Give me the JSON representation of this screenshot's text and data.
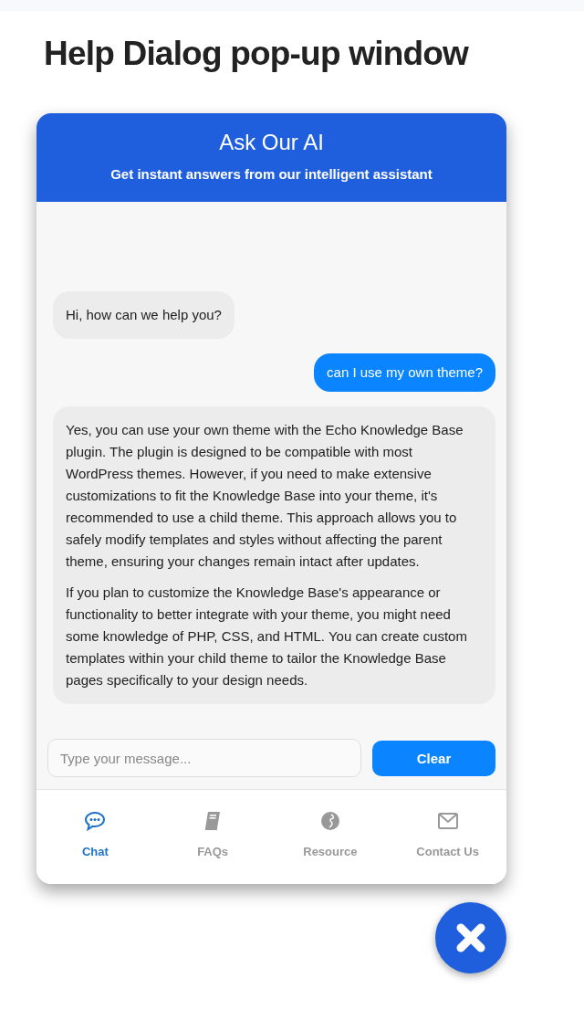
{
  "page_title": "Help Dialog pop-up window",
  "dialog": {
    "title": "Ask Our AI",
    "subtitle": "Get instant answers from our intelligent assistant"
  },
  "messages": [
    {
      "kind": "bot",
      "paragraphs": [
        "Hi, how can we help you?"
      ]
    },
    {
      "kind": "user",
      "paragraphs": [
        "can I use my own theme?"
      ]
    },
    {
      "kind": "bot",
      "paragraphs": [
        "Yes, you can use your own theme with the Echo Knowledge Base plugin. The plugin is designed to be compatible with most WordPress themes. However, if you need to make extensive customizations to fit the Knowledge Base into your theme, it's recommended to use a child theme. This approach allows you to safely modify templates and styles without affecting the parent theme, ensuring your changes remain intact after updates.",
        "If you plan to customize the Knowledge Base's appearance or functionality to better integrate with your theme, you might need some knowledge of PHP, CSS, and HTML. You can create custom templates within your child theme to tailor the Knowledge Base pages specifically to your design needs."
      ]
    }
  ],
  "input": {
    "placeholder": "Type your message..."
  },
  "clear_button": "Clear",
  "tabs": [
    {
      "label": "Chat",
      "kind": "chat",
      "selected": true
    },
    {
      "label": "FAQs",
      "kind": "book",
      "selected": false
    },
    {
      "label": "Resource",
      "kind": "globe",
      "selected": false
    },
    {
      "label": "Contact Us",
      "kind": "mail",
      "selected": false
    }
  ]
}
